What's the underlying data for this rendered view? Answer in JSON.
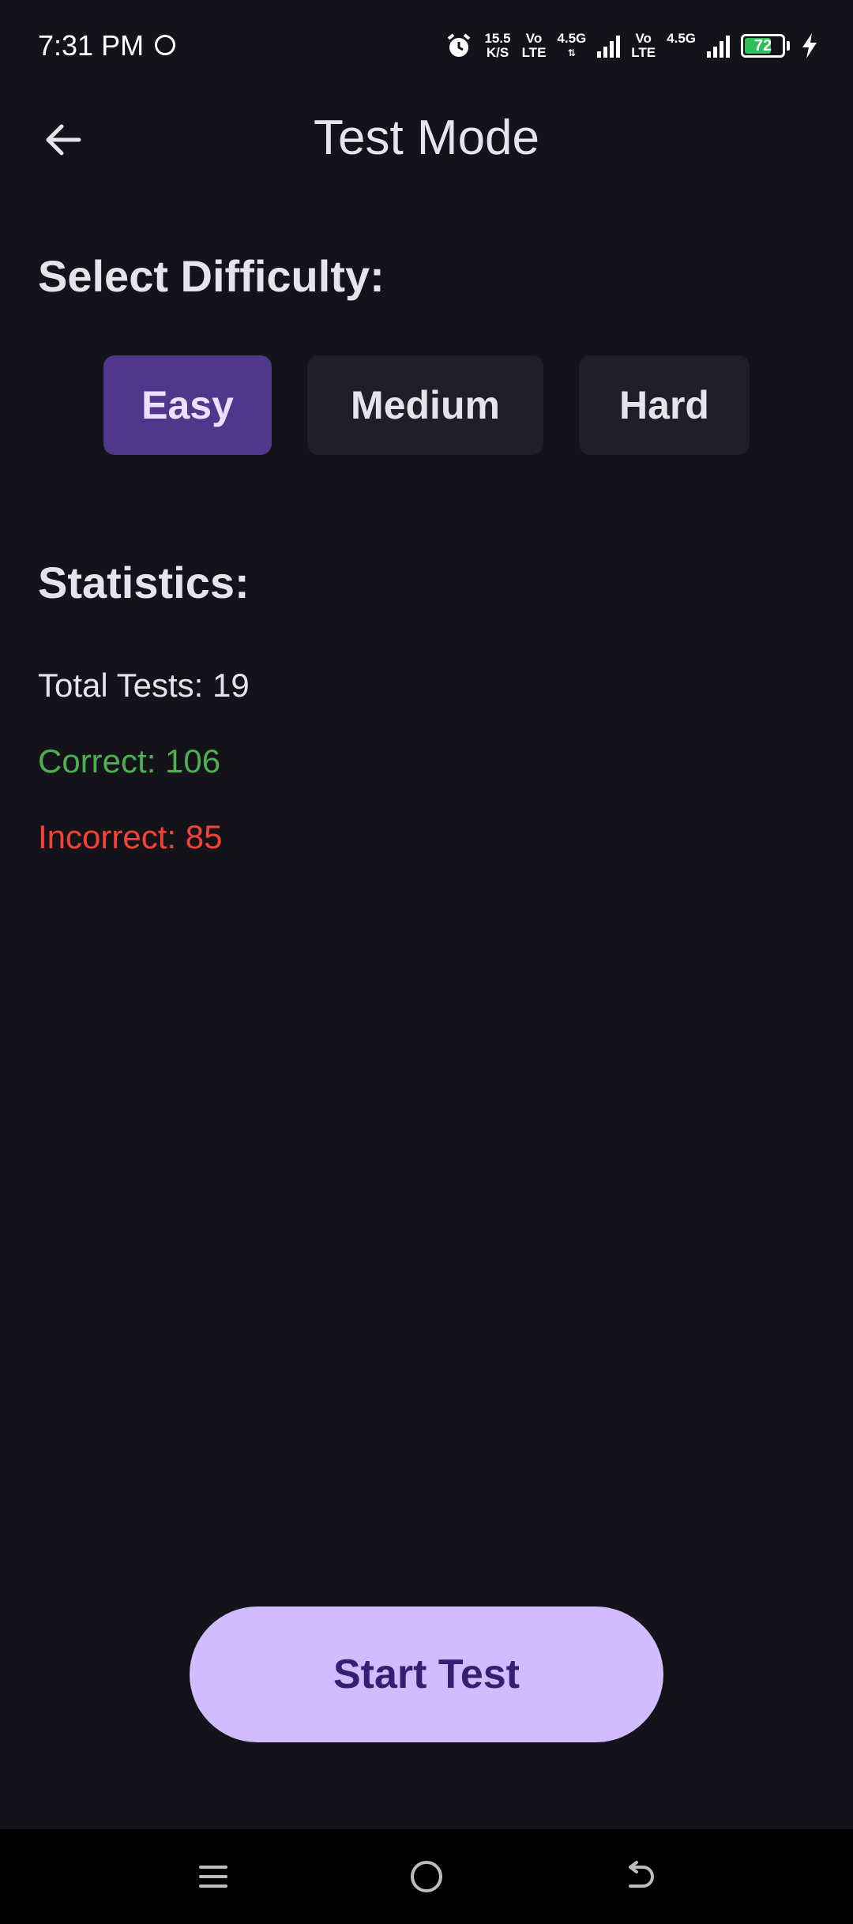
{
  "status_bar": {
    "time": "7:31 PM",
    "net_speed_value": "15.5",
    "net_speed_unit": "K/S",
    "sim1_top": "Vo",
    "sim1_bottom": "LTE",
    "sim1_net": "4.5G",
    "sim2_top": "Vo",
    "sim2_bottom": "LTE",
    "sim2_net": "4.5G",
    "battery_level": "72",
    "battery_fraction": 0.72,
    "battery_color": "#2fbf58"
  },
  "app_bar": {
    "title": "Test Mode",
    "back_icon": "arrow-back-icon"
  },
  "difficulty": {
    "heading": "Select Difficulty:",
    "options": [
      {
        "label": "Easy",
        "selected": true
      },
      {
        "label": "Medium",
        "selected": false
      },
      {
        "label": "Hard",
        "selected": false
      }
    ],
    "selected_color": "#4f378b"
  },
  "statistics": {
    "heading": "Statistics:",
    "total_tests": "Total Tests: 19",
    "correct": "Correct: 106",
    "incorrect": "Incorrect: 85",
    "correct_color": "#4caf50",
    "incorrect_color": "#f44336"
  },
  "actions": {
    "start_label": "Start Test",
    "start_color": "#d0bcff"
  },
  "nav_bar": {
    "menu_icon": "menu-icon",
    "home_icon": "home-circle-icon",
    "back_icon": "back-arrow-icon"
  }
}
